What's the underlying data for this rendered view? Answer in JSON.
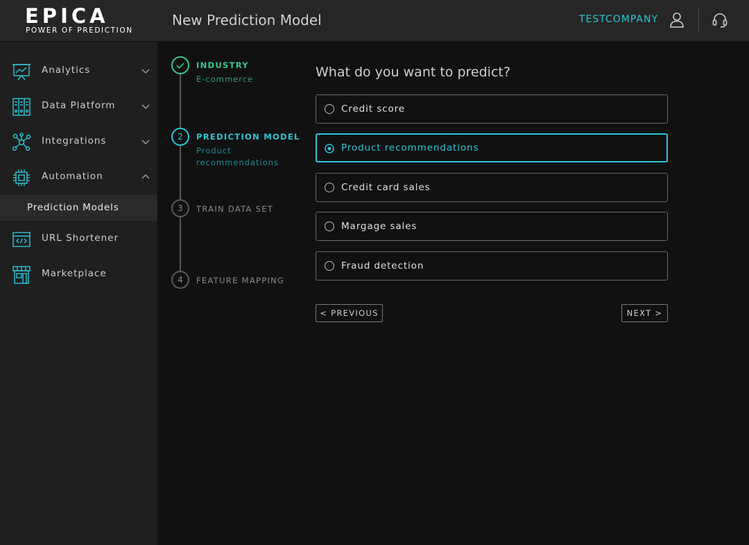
{
  "brand": {
    "name": "EPICA",
    "tagline": "POWER OF PREDICTION"
  },
  "header": {
    "title": "New Prediction Model",
    "company": "TESTCOMPANY",
    "icons": [
      "user-icon",
      "headset-support-icon"
    ]
  },
  "sidebar": {
    "items": [
      {
        "label": "Analytics",
        "icon": "analytics-presentation-icon",
        "expanded": false
      },
      {
        "label": "Data Platform",
        "icon": "data-platform-icon",
        "expanded": false
      },
      {
        "label": "Integrations",
        "icon": "integrations-network-icon",
        "expanded": false
      },
      {
        "label": "Automation",
        "icon": "automation-chip-icon",
        "expanded": true
      },
      {
        "label": "URL Shortener",
        "icon": "url-code-window-icon"
      },
      {
        "label": "Marketplace",
        "icon": "marketplace-store-icon"
      }
    ],
    "subitem": {
      "label": "Prediction Models",
      "active": true
    }
  },
  "steps": [
    {
      "number": "",
      "title": "INDUSTRY",
      "subtitle": "E-commerce",
      "status": "done"
    },
    {
      "number": "2",
      "title": "PREDICTION MODEL",
      "subtitle": "Product recommendations",
      "status": "active"
    },
    {
      "number": "3",
      "title": "TRAIN DATA SET",
      "subtitle": "",
      "status": "pending"
    },
    {
      "number": "4",
      "title": "FEATURE MAPPING",
      "subtitle": "",
      "status": "pending"
    }
  ],
  "main": {
    "question": "What do you want to predict?",
    "options": [
      {
        "label": "Credit score",
        "selected": false
      },
      {
        "label": "Product recommendations",
        "selected": true
      },
      {
        "label": "Credit card sales",
        "selected": false
      },
      {
        "label": "Margage sales",
        "selected": false
      },
      {
        "label": "Fraud detection",
        "selected": false
      }
    ],
    "previous_label": "< PREVIOUS",
    "next_label": "NEXT >"
  },
  "colors": {
    "accent": "#2bc6d8",
    "success": "#37c98a",
    "background": "#111111",
    "sidebar": "#1f1f1f",
    "header": "#262626"
  }
}
